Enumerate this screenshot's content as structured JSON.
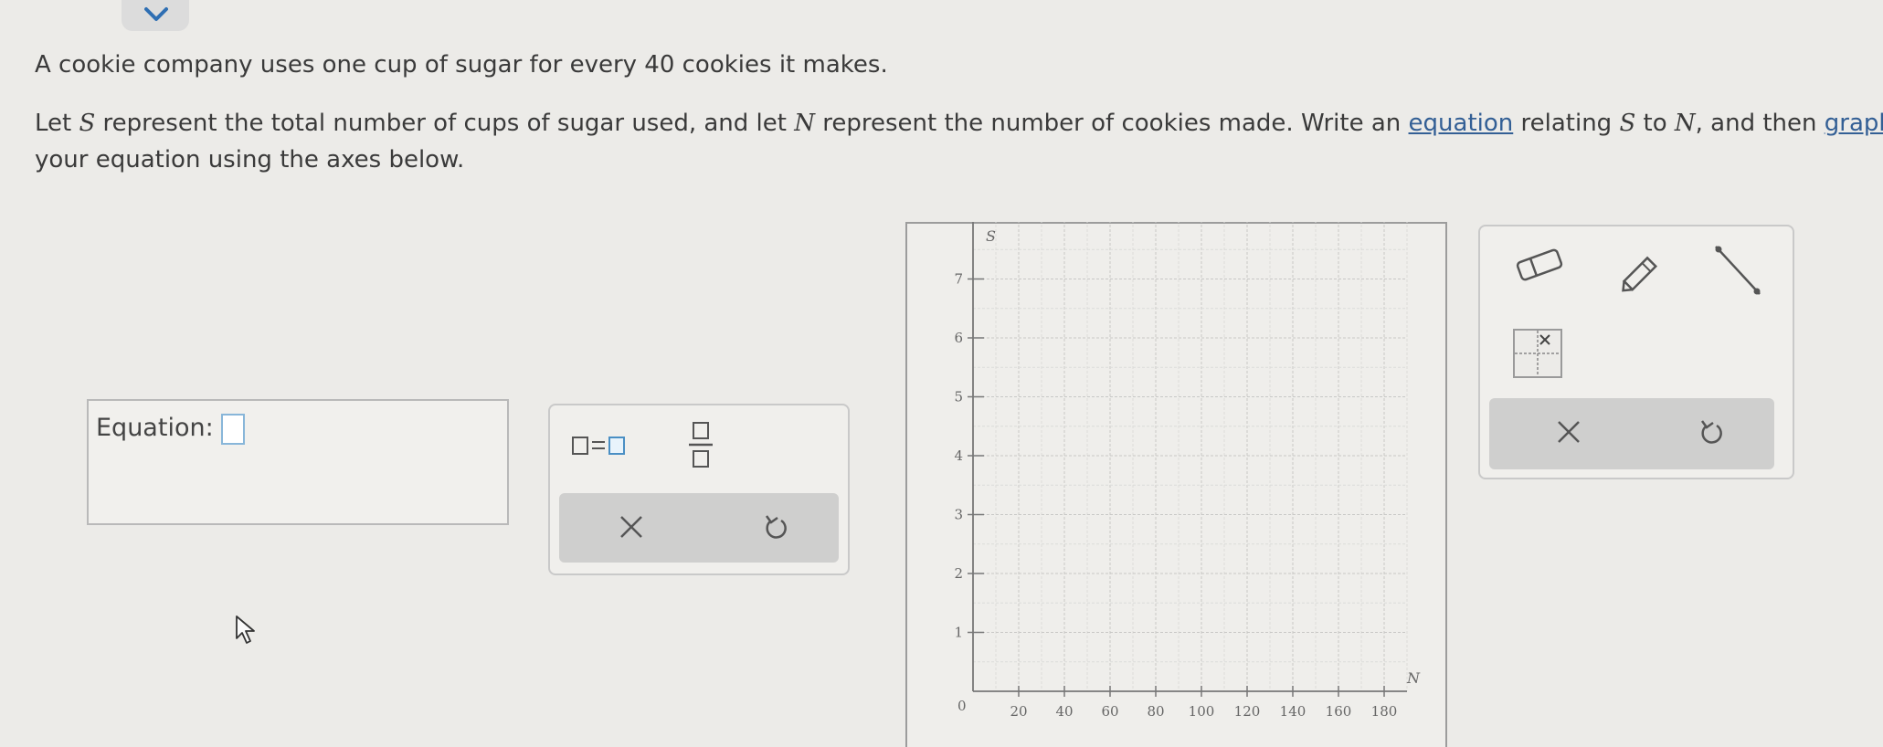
{
  "question": {
    "line1": "A cookie company uses one cup of sugar for every 40 cookies it makes.",
    "line2_a": "Let ",
    "var_s": "S",
    "line2_b": " represent the total number of cups of sugar used, and let ",
    "var_n": "N",
    "line2_c": " represent the number of cookies made. Write an ",
    "link_equation": "equation",
    "line2_d": " relating ",
    "line2_e": " to ",
    "line2_f": ", and then ",
    "link_graph": "graph",
    "line3": "your equation using the axes below."
  },
  "equation": {
    "label": "Equation:",
    "value": ""
  },
  "equation_toolbar": {
    "equals_button": "equals-template",
    "fraction_button": "fraction-template",
    "clear_button": "×",
    "undo_button": "undo"
  },
  "graph": {
    "y_axis_label": "S",
    "x_axis_label": "N",
    "origin_label": "0",
    "x_ticks": [
      "20",
      "40",
      "60",
      "80",
      "100",
      "120",
      "140",
      "160",
      "180"
    ],
    "y_ticks": [
      "1",
      "2",
      "3",
      "4",
      "5",
      "6",
      "7"
    ],
    "x_range": [
      0,
      190
    ],
    "y_range": [
      0,
      8
    ],
    "grid": true
  },
  "graph_toolbar": {
    "tools": [
      "eraser-icon",
      "pencil-icon",
      "line-tool-icon",
      "grid-point-icon"
    ],
    "clear_button": "×",
    "undo_button": "undo"
  }
}
